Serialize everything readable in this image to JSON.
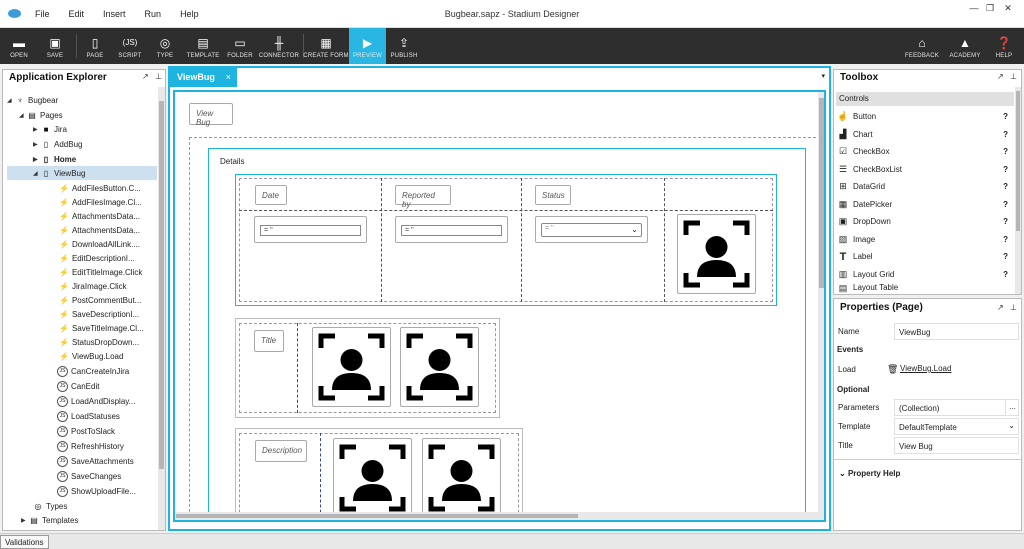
{
  "window": {
    "title": "Bugbear.sapz - Stadium Designer"
  },
  "menu": [
    "File",
    "Edit",
    "Insert",
    "Run",
    "Help"
  ],
  "toolbar": {
    "open": "OPEN",
    "save": "SAVE",
    "page": "PAGE",
    "script": "SCRIPT",
    "type": "TYPE",
    "template": "TEMPLATE",
    "folder": "FOLDER",
    "connector": "CONNECTOR",
    "create_form": "CREATE FORM",
    "preview": "PREVIEW",
    "publish": "PUBLISH",
    "feedback": "FEEDBACK",
    "academy": "ACADEMY",
    "help": "HELP",
    "script_icon": "(JS)"
  },
  "explorer": {
    "title": "Application Explorer",
    "root": "Bugbear",
    "pages": "Pages",
    "items": {
      "jira": "Jira",
      "addbug": "AddBug",
      "home": "Home",
      "viewbug": "ViewBug"
    },
    "events": [
      "AddFilesButton.C...",
      "AddFilesImage.Cl...",
      "AttachmentsData...",
      "AttachmentsData...",
      "DownloadAllLink....",
      "EditDescriptionI...",
      "EditTitleImage.Click",
      "JiraImage.Click",
      "PostCommentBut...",
      "SaveDescriptionI...",
      "SaveTitleImage.Cl...",
      "StatusDropDown...",
      "ViewBug.Load"
    ],
    "scripts": [
      "CanCreateInJira",
      "CanEdit",
      "LoadAndDisplay...",
      "LoadStatuses",
      "PostToSlack",
      "RefreshHistory",
      "SaveAttachments",
      "SaveChanges",
      "ShowUploadFile..."
    ],
    "types": "Types",
    "templates": "Templates",
    "js_icon": "JS"
  },
  "doc_tab": {
    "label": "ViewBug",
    "close": "×"
  },
  "canvas": {
    "page_label": "View Bug",
    "details": "Details",
    "date": "Date",
    "reported_by": "Reported by",
    "status": "Status",
    "date_val": "= ''",
    "reported_val": "= ''",
    "status_val": "= ''",
    "title": "Title",
    "description": "Description"
  },
  "toolbox": {
    "title": "Toolbox",
    "section": "Controls",
    "items": [
      "Button",
      "Chart",
      "CheckBox",
      "CheckBoxList",
      "DataGrid",
      "DatePicker",
      "DropDown",
      "Image",
      "Label",
      "Layout Grid",
      "Layout Table"
    ],
    "help": "?"
  },
  "properties": {
    "title": "Properties (Page)",
    "name_label": "Name",
    "name_val": "ViewBug",
    "events": "Events",
    "load_label": "Load",
    "load_val": "ViewBug.Load",
    "optional": "Optional",
    "params_label": "Parameters",
    "params_val": "(Collection)",
    "template_label": "Template",
    "template_val": "DefaultTemplate",
    "title_label": "Title",
    "title_val": "View Bug",
    "prop_help": "Property Help",
    "ellipsis": "..."
  },
  "status": {
    "validations": "Validations"
  },
  "colors": {
    "accent": "#1fb4e0",
    "toolbar": "#2e2e2e"
  }
}
